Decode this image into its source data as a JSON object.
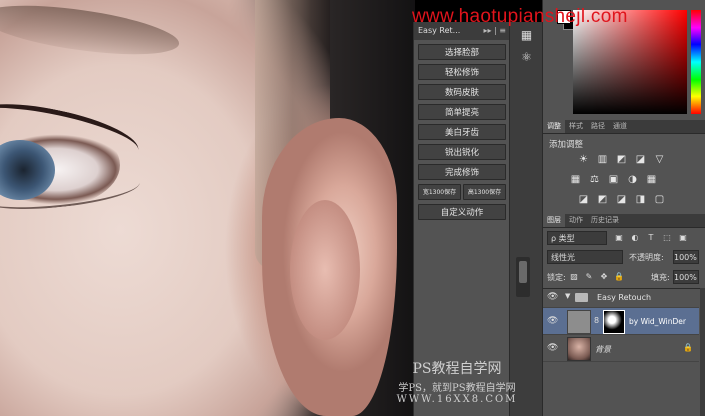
{
  "watermark": {
    "top": "www.haotupianshejl.com",
    "bottom_line1": "PS教程自学网",
    "bottom_line2": "学PS，就到PS教程自学网",
    "bottom_line3": "WWW.16XX8.COM"
  },
  "actions_panel": {
    "title": "Easy Ret...",
    "header_controls": "▸▸ | ≡",
    "buttons": [
      "选择脸部",
      "轻松修饰",
      "数码皮肤",
      "简单提亮",
      "美白牙齿",
      "锐出锐化",
      "完成修饰"
    ],
    "half_buttons": [
      "宽1300保存",
      "高1300保存"
    ],
    "custom_button": "自定义动作"
  },
  "icon_strip": {
    "icons": [
      "history-icon",
      "atom-icon"
    ]
  },
  "color_panel": {
    "foreground": "#ffffff",
    "background": "#000000"
  },
  "adjustments": {
    "tabs": [
      "调整",
      "样式",
      "路径",
      "通道"
    ],
    "title": "添加调整",
    "row1": [
      "☀",
      "▥",
      "◩",
      "◪",
      "▽"
    ],
    "row2": [
      "▦",
      "⚖",
      "▣",
      "◑",
      "▦"
    ],
    "row3": [
      "◪",
      "◩",
      "◪",
      "◨",
      "▢"
    ]
  },
  "layers": {
    "tabs": [
      "图层",
      "动作",
      "历史记录"
    ],
    "filter_label": "ρ 类型",
    "filter_icons": [
      "▣",
      "◐",
      "T",
      "⬚",
      "▣"
    ],
    "blend_mode": "线性光",
    "opacity_label": "不透明度:",
    "opacity_value": "100%",
    "lock_label": "锁定:",
    "lock_icons": [
      "▨",
      "✎",
      "✥",
      "🔒"
    ],
    "fill_label": "填充:",
    "fill_value": "100%",
    "group_name": "Easy Retouch",
    "adjustment_layer_name": "by Wid_WinDer",
    "background_layer_name": "背景",
    "eye_glyph": "👁",
    "chain_glyph": "8",
    "lock_glyph": "🔒",
    "group_arrow": "▼"
  }
}
